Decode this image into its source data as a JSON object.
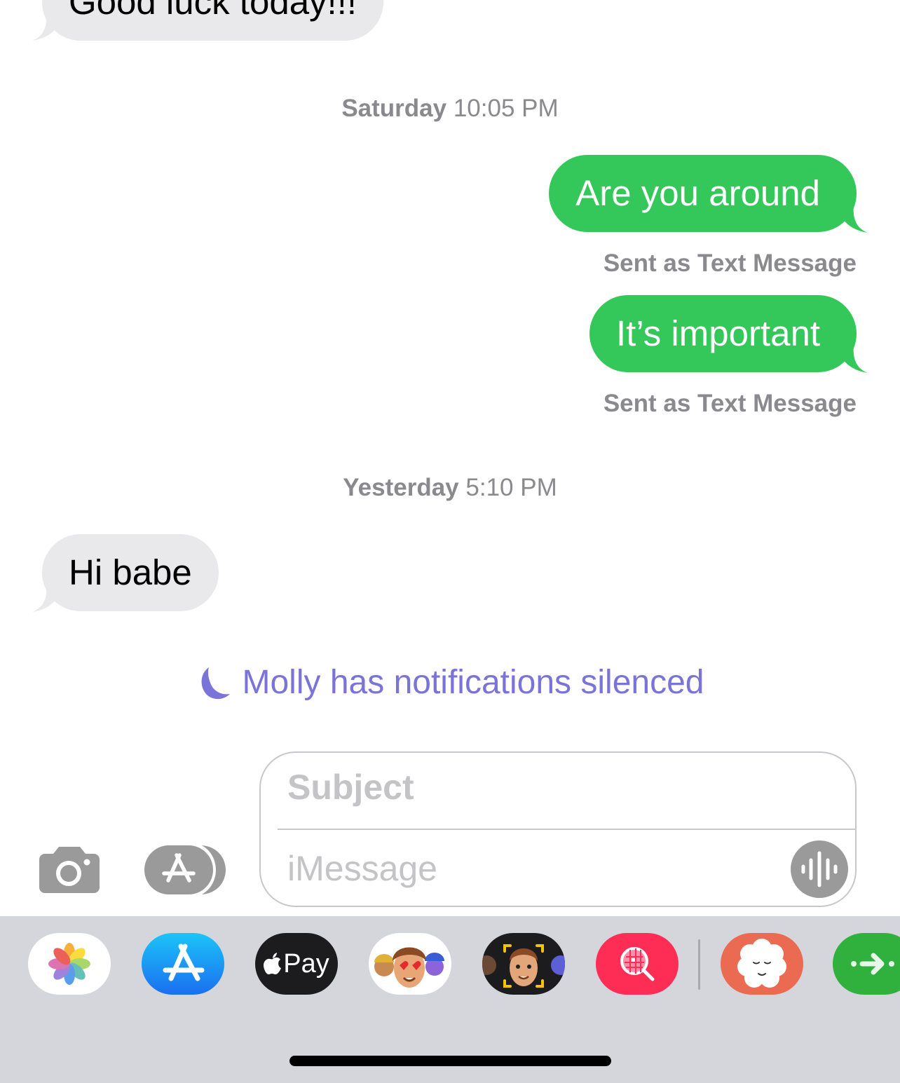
{
  "conversation": {
    "contact_name": "Molly",
    "messages": [
      {
        "direction": "incoming",
        "text": "Good luck today!!!"
      },
      {
        "type": "timestamp",
        "day": "Saturday",
        "time": "10:05 PM"
      },
      {
        "direction": "outgoing",
        "text": "Are you around",
        "status": "Sent as Text Message"
      },
      {
        "direction": "outgoing",
        "text": "It’s important",
        "status": "Sent as Text Message"
      },
      {
        "type": "timestamp",
        "day": "Yesterday",
        "time": "5:10 PM"
      },
      {
        "direction": "incoming",
        "text": "Hi babe"
      }
    ],
    "silenced_notice": "Molly has notifications silenced",
    "silenced_icon": "moon-icon"
  },
  "compose": {
    "subject_placeholder": "Subject",
    "message_placeholder": "iMessage",
    "camera_icon": "camera-icon",
    "apps_icon": "app-store-icon",
    "audio_icon": "waveform-icon"
  },
  "app_tray": {
    "apps": [
      {
        "name": "Photos",
        "icon": "photos-icon"
      },
      {
        "name": "App Store",
        "icon": "app-store-icon"
      },
      {
        "name": "Apple Pay",
        "label": "Pay",
        "icon": "apple-pay-icon"
      },
      {
        "name": "Memoji Stickers",
        "icon": "memoji-stickers-icon"
      },
      {
        "name": "Memoji",
        "icon": "memoji-icon"
      },
      {
        "name": "Images Search",
        "icon": "image-search-icon"
      },
      {
        "name": "Calm",
        "icon": "calm-cloud-icon"
      },
      {
        "name": "Activity",
        "icon": "arrow-right-icon"
      }
    ]
  },
  "colors": {
    "outgoing_sms": "#34c759",
    "incoming": "#e9e9eb",
    "silenced": "#7a73d8",
    "tray_bg": "#d5d6db"
  }
}
